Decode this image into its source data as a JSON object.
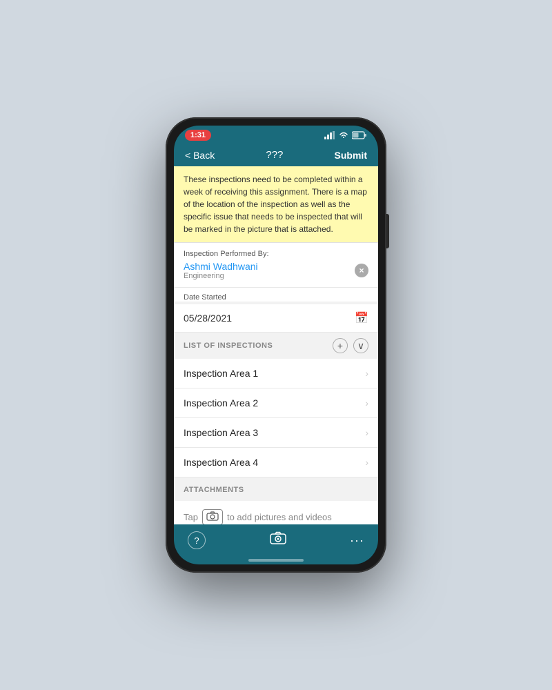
{
  "statusBar": {
    "time": "1:31",
    "signal": "signal-icon",
    "wifi": "wifi-icon",
    "battery": "battery-icon"
  },
  "navBar": {
    "backLabel": "< Back",
    "title": "???",
    "submitLabel": "Submit"
  },
  "noteSection": {
    "text": "These inspections need to be completed within a week of receiving this assignment. There is a map of the location of the inspection as well as the specific issue that needs to be inspected that will be marked in the picture that is attached."
  },
  "inspectionPerformedBy": {
    "label": "Inspection Performed By:",
    "name": "Ashmi Wadhwani",
    "department": "Engineering"
  },
  "dateStarted": {
    "label": "Date Started",
    "value": "05/28/2021"
  },
  "listOfInspections": {
    "sectionTitle": "LIST OF INSPECTIONS",
    "addIcon": "+",
    "collapseIcon": "∨",
    "items": [
      {
        "label": "Inspection Area 1"
      },
      {
        "label": "Inspection Area 2"
      },
      {
        "label": "Inspection Area 3"
      },
      {
        "label": "Inspection Area 4"
      }
    ]
  },
  "attachments": {
    "sectionTitle": "ATTACHMENTS",
    "tapText": "Tap",
    "toAddText": "to add pictures and videos"
  },
  "bottomToolbar": {
    "helpIcon": "?",
    "cameraIcon": "⊙",
    "moreIcon": "···"
  }
}
